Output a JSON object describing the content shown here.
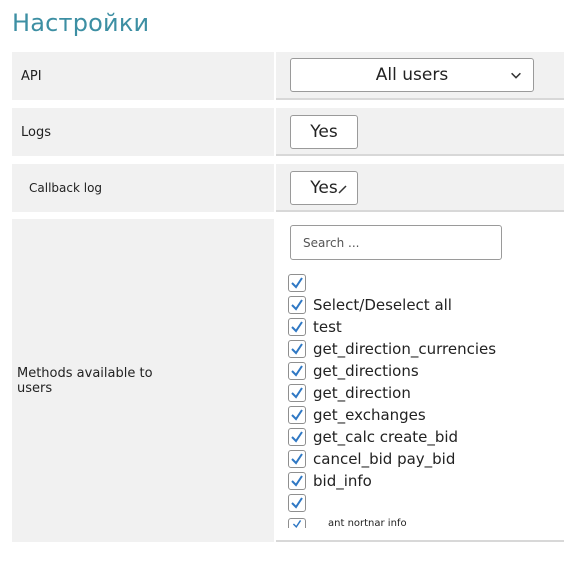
{
  "page": {
    "title": "Настройки"
  },
  "rows": {
    "api": {
      "label": "API",
      "value": "All users"
    },
    "logs": {
      "label": "Logs",
      "value": "Yes"
    },
    "callback_log": {
      "label": "Callback log",
      "value": "Yes"
    },
    "methods": {
      "label_line_1": "Methods available to",
      "label_line_2": "users",
      "search_placeholder": "Search ...",
      "items": [
        {
          "label": "",
          "checked": true
        },
        {
          "label": "Select/Deselect all",
          "checked": true
        },
        {
          "label": "test",
          "checked": true
        },
        {
          "label": "get_direction_currencies",
          "checked": true
        },
        {
          "label": "get_directions",
          "checked": true
        },
        {
          "label": "get_direction",
          "checked": true
        },
        {
          "label": "get_exchanges",
          "checked": true
        },
        {
          "label": "get_calc create_bid",
          "checked": true
        },
        {
          "label": "cancel_bid pay_bid",
          "checked": true
        },
        {
          "label": "bid_info",
          "checked": true
        },
        {
          "label": "",
          "checked": true
        },
        {
          "label": "ant nortnar info",
          "checked": true
        }
      ]
    }
  },
  "colors": {
    "title": "#3d8fa3",
    "check": "#2f78c4"
  },
  "icons": {
    "dropdown": "chevron-down-icon",
    "edit": "pencil-icon",
    "check": "check-icon"
  }
}
